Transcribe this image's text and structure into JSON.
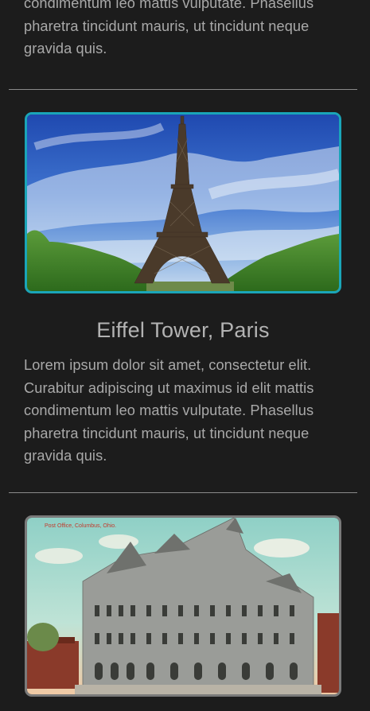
{
  "articles": [
    {
      "title": "",
      "body_lines": [
        "condimentum leo mattis vulputate. Phasellus",
        "pharetra tincidunt mauris, ut tincidunt neque",
        "gravida quis."
      ]
    },
    {
      "title": "Eiffel Tower, Paris",
      "image_name": "eiffel-tower-photo",
      "border_color": "#1aa5b8",
      "body_lines": [
        "Lorem ipsum dolor sit amet, consectetur elit.",
        "Curabitur adipiscing ut maximus id elit mattis",
        "condimentum leo mattis vulputate. Phasellus",
        "pharetra tincidunt mauris, ut tincidunt neque",
        "gravida quis."
      ]
    },
    {
      "title": "",
      "image_name": "post-office-columbus-postcard",
      "image_caption": "Post Office, Columbus, Ohio.",
      "border_color": "#7a7a7a"
    }
  ],
  "colors": {
    "background": "#1c1c1c",
    "text": "#a9a9a9",
    "divider": "#8a8a8a",
    "accent_border": "#1aa5b8"
  }
}
